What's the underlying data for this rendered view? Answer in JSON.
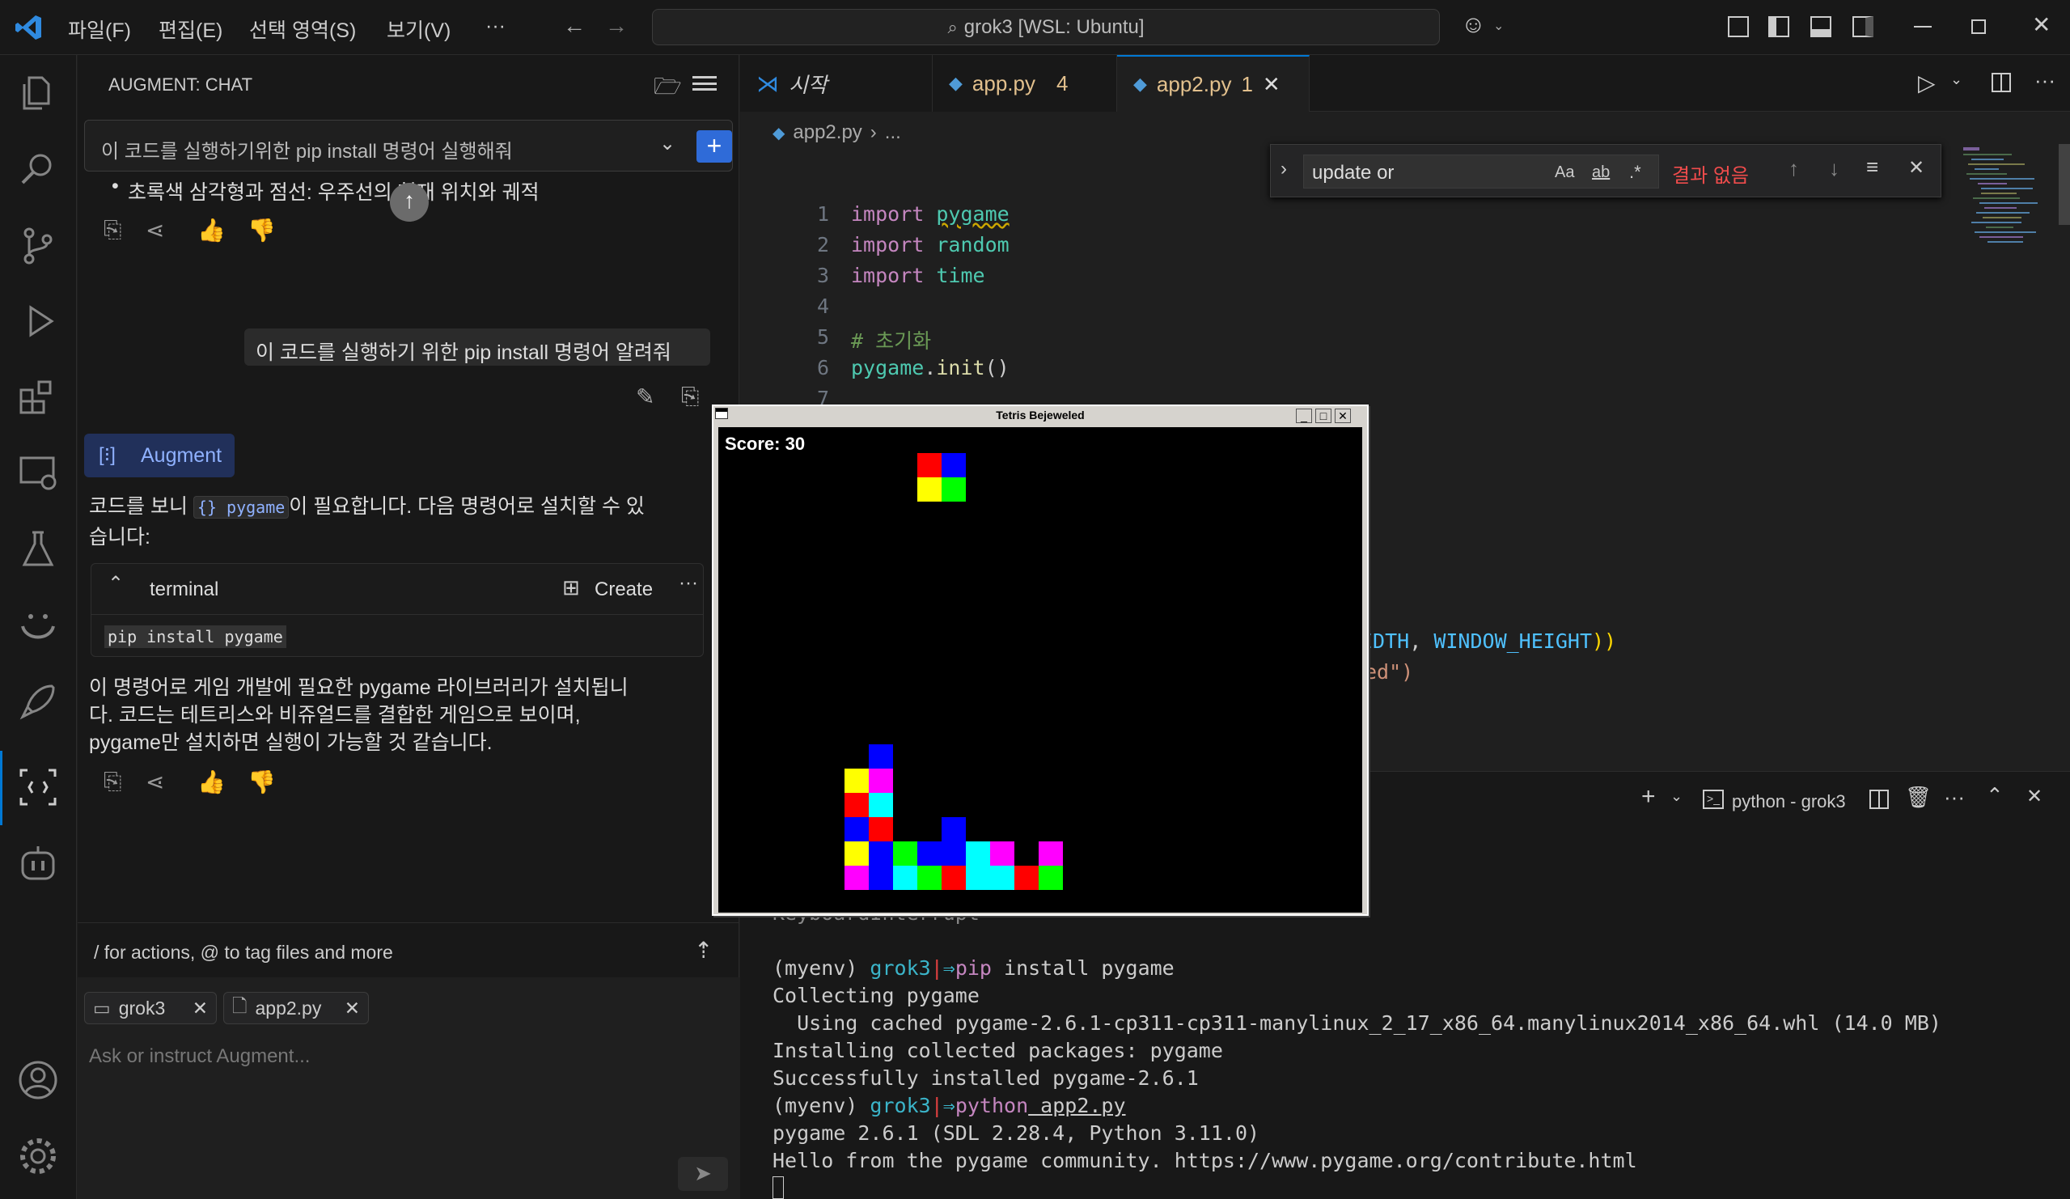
{
  "titlebar": {
    "menus": [
      "파일(F)",
      "편집(E)",
      "선택 영역(S)",
      "보기(V)",
      "···"
    ],
    "search": "grok3 [WSL: Ubuntu]"
  },
  "side": {
    "title": "AUGMENT: CHAT",
    "thread_title": "이 코드를 실행하기위한 pip install 명령어 실행해줘",
    "prev_bullet": "초록색 삼각형과 점선: 우주선의 현재 위치와 궤적",
    "user_message": "이 코드를 실행하기 위한 pip install 명령어 알려줘",
    "agent_badge": "Augment",
    "reply_before_a": "코드를 보니",
    "reply_code": "{} pygame",
    "reply_before_b": "이 필요합니다. 다음 명령어로 설치할 수 있",
    "reply_before_c": "습니다:",
    "block_title": "terminal",
    "block_create": "Create",
    "block_code": "pip install pygame",
    "reply_after_a": "이 명령어로 게임 개발에 필요한 pygame 라이브러리가 설치됩니",
    "reply_after_b": "다. 코드는 테트리스와 비쥬얼드를 결합한 게임으로 보이며,",
    "reply_after_c": "pygame만 설치하면 실행이 가능할 것 같습니다.",
    "hint": "/ for actions, @ to tag files and more",
    "chip1": "grok3",
    "chip2": "app2.py",
    "placeholder": "Ask or instruct Augment..."
  },
  "tabs": [
    {
      "label": "시작",
      "badge": ""
    },
    {
      "label": "app.py",
      "badge": "4"
    },
    {
      "label": "app2.py",
      "badge": "1"
    }
  ],
  "breadcrumb": {
    "file": "app2.py",
    "rest": "..."
  },
  "find": {
    "value": "update or",
    "opt1": "Aa",
    "opt2": "ab",
    "opt3": ".*",
    "result": "결과 없음"
  },
  "code": {
    "lines": [
      "1",
      "2",
      "3",
      "4",
      "5",
      "6",
      "7"
    ],
    "l1a": "import",
    "l1b": "pygame",
    "l2a": "import",
    "l2b": "random",
    "l3a": "import",
    "l3b": "time",
    "l5": "# 초기화",
    "l6a": "pygame",
    "l6b": ".",
    "l6c": "init",
    "l6d": "()",
    "frag1a": "IDTH",
    "frag1b": ", ",
    "frag1c": "WINDOW_HEIGHT",
    "frag1d": "))",
    "frag2": "ed\")"
  },
  "terminal": {
    "title": "python - grok3",
    "l0": "KeyboardInterrupt",
    "l1a": "(myenv) ",
    "l1b": "grok3",
    "l1c": "|",
    "l1d": "⇒",
    "l1e": "pip",
    "l1f": " install pygame",
    "l2": "Collecting pygame",
    "l3": "  Using cached pygame-2.6.1-cp311-cp311-manylinux_2_17_x86_64.manylinux2014_x86_64.whl (14.0 MB)",
    "l4": "Installing collected packages: pygame",
    "l5": "Successfully installed pygame-2.6.1",
    "l6a": "(myenv) ",
    "l6b": "grok3",
    "l6c": "|",
    "l6d": "⇒",
    "l6e": "python",
    "l6f": " app2.py",
    "l7": "pygame 2.6.1 (SDL 2.28.4, Python 3.11.0)",
    "l8": "Hello from the pygame community. https://www.pygame.org/contribute.html"
  },
  "game": {
    "title": "Tetris Bejeweled",
    "score": "Score: 30",
    "colors": {
      "R": "#ff0000",
      "G": "#00ff00",
      "B": "#0000ff",
      "Y": "#ffff00",
      "M": "#ff00ff",
      "C": "#00ffff"
    },
    "falling": [
      [
        0,
        0,
        "R"
      ],
      [
        1,
        0,
        "B"
      ],
      [
        0,
        1,
        "Y"
      ],
      [
        1,
        1,
        "G"
      ]
    ],
    "falling_origin": [
      7,
      1
    ],
    "stack": [
      [
        5,
        0,
        "B"
      ],
      [
        4,
        1,
        "Y"
      ],
      [
        5,
        1,
        "M"
      ],
      [
        4,
        2,
        "R"
      ],
      [
        5,
        2,
        "C"
      ],
      [
        4,
        3,
        "B"
      ],
      [
        5,
        3,
        "R"
      ],
      [
        8,
        3,
        "B"
      ],
      [
        4,
        4,
        "Y"
      ],
      [
        5,
        4,
        "B"
      ],
      [
        6,
        4,
        "G"
      ],
      [
        7,
        4,
        "B"
      ],
      [
        8,
        4,
        "B"
      ],
      [
        9,
        4,
        "C"
      ],
      [
        10,
        4,
        "M"
      ],
      [
        12,
        4,
        "M"
      ],
      [
        4,
        5,
        "M"
      ],
      [
        5,
        5,
        "B"
      ],
      [
        6,
        5,
        "C"
      ],
      [
        7,
        5,
        "G"
      ],
      [
        8,
        5,
        "R"
      ],
      [
        9,
        5,
        "C"
      ],
      [
        10,
        5,
        "C"
      ],
      [
        11,
        5,
        "R"
      ],
      [
        12,
        5,
        "G"
      ]
    ],
    "stack_origin_row": 13
  }
}
